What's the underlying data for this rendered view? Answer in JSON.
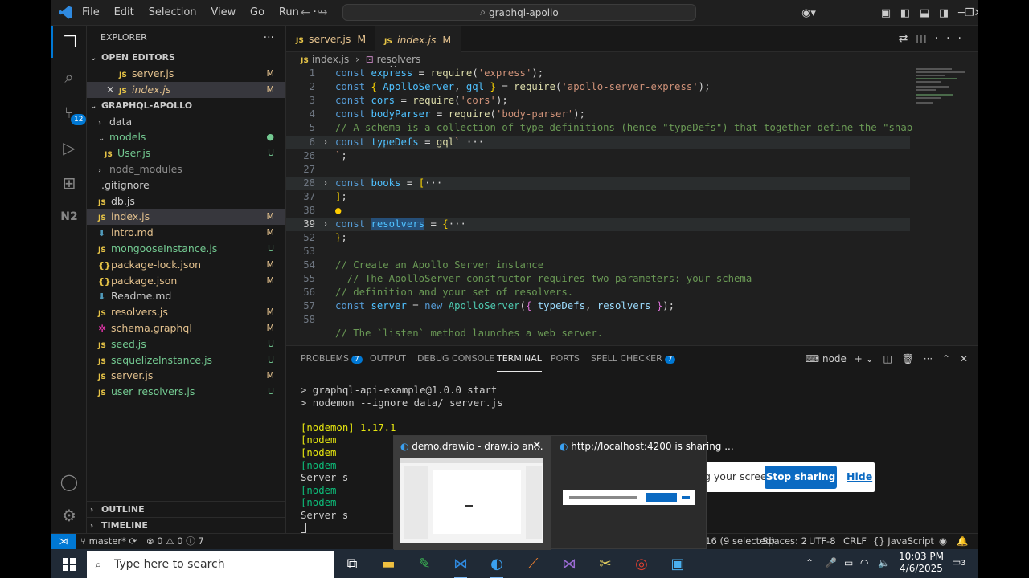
{
  "titlebar": {
    "menu": [
      "File",
      "Edit",
      "Selection",
      "View",
      "Go",
      "Run",
      "···"
    ],
    "search": "graphql-apollo"
  },
  "activity": {
    "source_control_badge": "12"
  },
  "explorer": {
    "header": "EXPLORER",
    "more": "···",
    "open_editors_label": "OPEN EDITORS",
    "open_editors": [
      {
        "name": "server.js",
        "status": "M"
      },
      {
        "name": "index.js",
        "status": "M"
      }
    ],
    "project_label": "GRAPHQL-APOLLO",
    "tree": [
      {
        "name": "data",
        "type": "folder",
        "status": ""
      },
      {
        "name": "models",
        "type": "folder-open",
        "status": "●"
      },
      {
        "name": "User.js",
        "type": "js",
        "status": "U"
      },
      {
        "name": "node_modules",
        "type": "folder",
        "status": ""
      },
      {
        "name": ".gitignore",
        "type": "git",
        "status": ""
      },
      {
        "name": "db.js",
        "type": "js",
        "status": ""
      },
      {
        "name": "index.js",
        "type": "js",
        "status": "M"
      },
      {
        "name": "intro.md",
        "type": "md",
        "status": "M"
      },
      {
        "name": "mongooseInstance.js",
        "type": "js",
        "status": "U"
      },
      {
        "name": "package-lock.json",
        "type": "json",
        "status": "M"
      },
      {
        "name": "package.json",
        "type": "json",
        "status": "M"
      },
      {
        "name": "Readme.md",
        "type": "md",
        "status": ""
      },
      {
        "name": "resolvers.js",
        "type": "js",
        "status": "M"
      },
      {
        "name": "schema.graphql",
        "type": "gql",
        "status": "M"
      },
      {
        "name": "seed.js",
        "type": "js",
        "status": "U"
      },
      {
        "name": "sequelizeInstance.js",
        "type": "js",
        "status": "U"
      },
      {
        "name": "server.js",
        "type": "js",
        "status": "M"
      },
      {
        "name": "user_resolvers.js",
        "type": "js",
        "status": "U"
      }
    ],
    "outline": "OUTLINE",
    "timeline": "TIMELINE"
  },
  "tabs": [
    {
      "name": "server.js",
      "status": "M"
    },
    {
      "name": "index.js",
      "status": "M"
    }
  ],
  "breadcrumb": {
    "file": "index.js",
    "symbol": "resolvers"
  },
  "editor": {
    "line_numbers": [
      "1",
      "2",
      "3",
      "4",
      "5",
      "6",
      "26",
      "27",
      "28",
      "37",
      "38",
      "39",
      "52",
      "53",
      "54",
      "55",
      "56",
      "57",
      "58"
    ]
  },
  "panel": {
    "tabs": [
      {
        "label": "PROBLEMS",
        "badge": "7"
      },
      {
        "label": "OUTPUT",
        "badge": ""
      },
      {
        "label": "DEBUG CONSOLE",
        "badge": ""
      },
      {
        "label": "TERMINAL",
        "badge": ""
      },
      {
        "label": "PORTS",
        "badge": ""
      },
      {
        "label": "SPELL CHECKER",
        "badge": "7"
      }
    ],
    "shell": "node",
    "terminal": [
      "> graphql-api-example@1.0.0 start",
      "> nodemon --ignore data/ server.js",
      "",
      "[nodemon] 1.17.1",
      "[nodem",
      "[nodem",
      "[nodem",
      "Server s",
      "[nodem",
      "[nodem",
      "Server s"
    ]
  },
  "status": {
    "branch": "master*",
    "errors": "0",
    "warnings": "0",
    "info": "7",
    "position": "Ln 39, Col 16 (9 selected)",
    "spaces": "Spaces: 2",
    "encoding": "UTF-8",
    "eol": "CRLF",
    "language": "JavaScript"
  },
  "taskbar": {
    "search_placeholder": "Type here to search",
    "time": "10:03 PM",
    "date": "4/6/2025",
    "notifications": "3"
  },
  "share_bar": {
    "message": "g your screen.",
    "stop": "Stop sharing",
    "hide": "Hide"
  },
  "previews": [
    {
      "title": "demo.drawio - draw.io an..."
    },
    {
      "title": "http://localhost:4200 is sharing ..."
    }
  ]
}
